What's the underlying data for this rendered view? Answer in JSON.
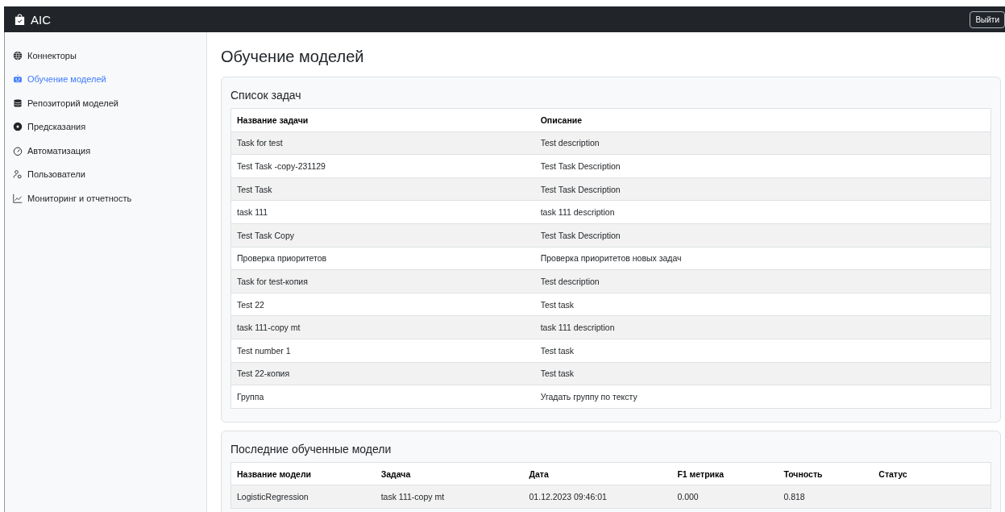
{
  "navbar": {
    "brand": "AIC",
    "logout": "Выйти"
  },
  "sidebar": {
    "items": [
      {
        "label": "Коннекторы",
        "selected": false
      },
      {
        "label": "Обучение моделей",
        "selected": true
      },
      {
        "label": "Репозиторий моделей",
        "selected": false
      },
      {
        "label": "Предсказания",
        "selected": false
      },
      {
        "label": "Автоматизация",
        "selected": false
      },
      {
        "label": "Пользователи",
        "selected": false
      },
      {
        "label": "Мониторинг и отчетность",
        "selected": false
      }
    ]
  },
  "page_title": "Обучение моделей",
  "tasks": {
    "title": "Список задач",
    "columns": [
      "Название задачи",
      "Описание"
    ],
    "rows": [
      [
        "Task for test",
        "Test description"
      ],
      [
        "Test Task -copy-231129",
        "Test Task Description"
      ],
      [
        "Test Task",
        "Test Task Description"
      ],
      [
        "task 111",
        "task 111 description"
      ],
      [
        "Test Task Copy",
        "Test Task Description"
      ],
      [
        "Проверка приоритетов",
        "Проверка приоритетов новых задач"
      ],
      [
        "Task for test-копия",
        "Test description"
      ],
      [
        "Test 22",
        "Test task"
      ],
      [
        "task 111-copy mt",
        "task 111 description"
      ],
      [
        "Test number 1",
        "Test task"
      ],
      [
        "Test 22-копия",
        "Test task"
      ],
      [
        "Группа",
        "Угадать группу по тексту"
      ]
    ]
  },
  "models": {
    "title": "Последние обученные модели",
    "columns": [
      "Название модели",
      "Задача",
      "Дата",
      "F1 метрика",
      "Точность",
      "Статус"
    ],
    "rows": [
      [
        "LogisticRegression",
        "task 111-copy mt",
        "01.12.2023 09:46:01",
        "0.000",
        "0.818"
      ]
    ]
  }
}
